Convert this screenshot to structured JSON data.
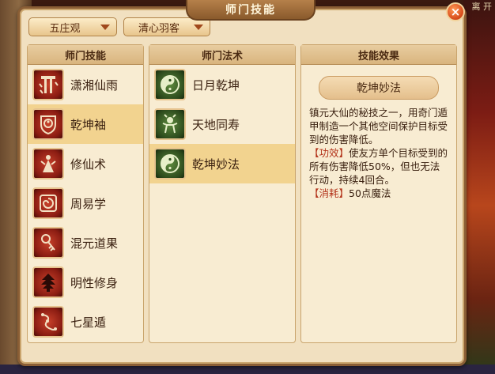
{
  "window": {
    "title": "师门技能",
    "close_label": "×"
  },
  "background": {
    "right_text": "离 开"
  },
  "filters": {
    "school": "五庄观",
    "sub_school": "清心羽客"
  },
  "columns": {
    "school_skills_header": "师门技能",
    "spells_header": "师门法术",
    "effect_header": "技能效果"
  },
  "school_skills": [
    {
      "name": "潇湘仙雨",
      "icon": "rain-pillar-icon"
    },
    {
      "name": "乾坤袖",
      "icon": "yin-yang-shield-icon"
    },
    {
      "name": "修仙术",
      "icon": "immortal-figure-icon"
    },
    {
      "name": "周易学",
      "icon": "swirl-seal-icon"
    },
    {
      "name": "混元道果",
      "icon": "orb-key-icon"
    },
    {
      "name": "明性修身",
      "icon": "tree-icon"
    },
    {
      "name": "七星遁",
      "icon": "seven-stars-icon"
    }
  ],
  "selected_school_skill_index": 1,
  "spells": [
    {
      "name": "日月乾坤",
      "icon": "yin-yang-icon"
    },
    {
      "name": "天地同寿",
      "icon": "creature-icon"
    },
    {
      "name": "乾坤妙法",
      "icon": "yin-yang-icon"
    }
  ],
  "selected_spell_index": 2,
  "effect": {
    "title": "乾坤妙法",
    "description": "镇元大仙的秘技之一，用奇门遁甲制造一个其他空间保护目标受到的伤害降低。",
    "effect_label": "【功效】",
    "effect_text": "使友方单个目标受到的所有伤害降低50%，但也无法行动，持续4回合。",
    "cost_label": "【消耗】",
    "cost_text": "50点魔法"
  }
}
